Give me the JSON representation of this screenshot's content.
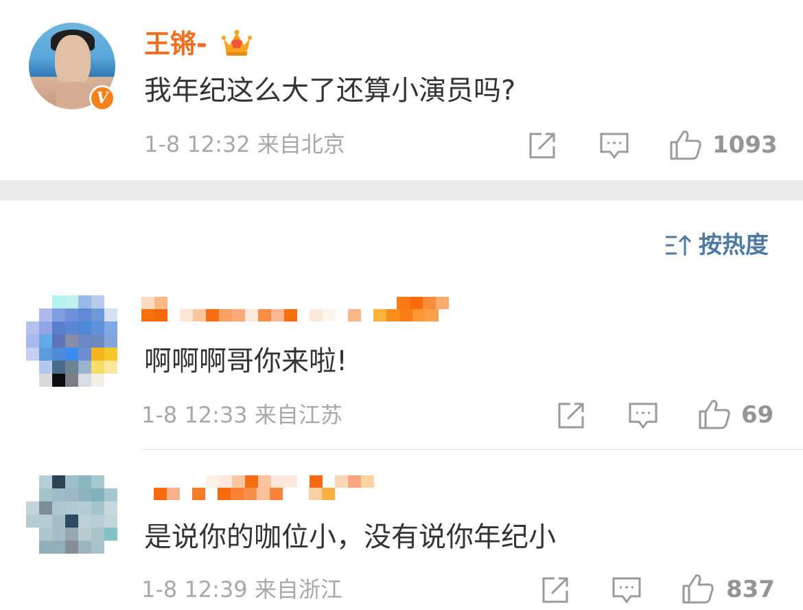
{
  "post": {
    "username": "王锵-",
    "avatar": "avatar",
    "verified_badge": "V",
    "text": "我年纪这么大了还算小演员吗?",
    "time": "1-8 12:32",
    "location": "来自北京",
    "likes": "1093"
  },
  "sort": {
    "label": "按热度",
    "icon": "sort-icon"
  },
  "comments": [
    {
      "username": "",
      "text": "啊啊啊哥你来啦!",
      "time": "1-8 12:33",
      "location": "来自江苏",
      "likes": "69"
    },
    {
      "username": "",
      "text": "是说你的咖位小，没有说你年纪小",
      "time": "1-8 12:39",
      "location": "来自浙江",
      "likes": "837"
    }
  ],
  "colors": {
    "username_orange": "#f26d1f",
    "meta_gray": "#a8a8a8",
    "sort_blue": "#4e79a5",
    "separator": "#ececec"
  },
  "icons": [
    "share-icon",
    "comment-icon",
    "like-icon",
    "crown-icon",
    "sort-icon"
  ]
}
